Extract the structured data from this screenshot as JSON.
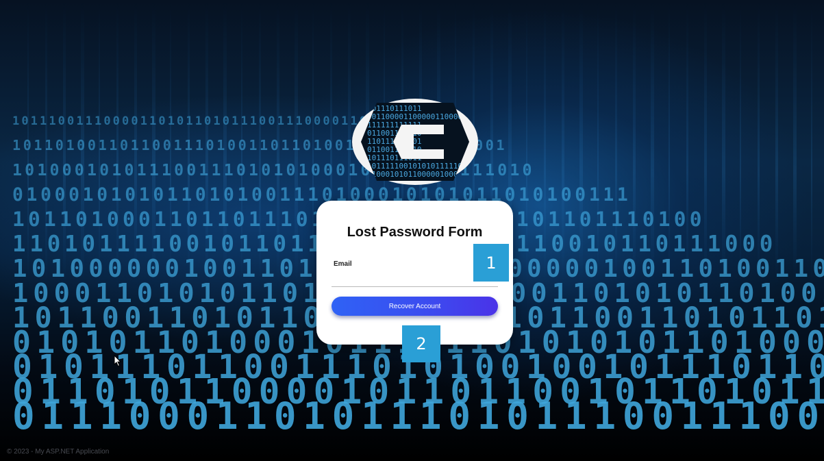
{
  "background": {
    "rows": [
      "1011100111000011010110",
      "10110100110110011101001",
      "101000101011100111010",
      "0100010101011010100111",
      "1011010001101101110100",
      "1101011110010110111000",
      "1010000001001101001101",
      "1000110101011010011101",
      "1011001101011010111010",
      "0101011010001011101101",
      "0101110110011101010010",
      "0110101100001011011001",
      "0111000110101110101110"
    ]
  },
  "footer": {
    "text": "© 2023 - My ASP.NET Application"
  },
  "logo": {
    "binary_rows": [
      "1011",
      "0011000011000",
      "1111",
      "0110",
      "1101",
      "0110",
      "1011",
      "1011111001010",
      "010001010110000"
    ]
  },
  "form": {
    "title": "Lost Password Form",
    "email_label": "Email",
    "email_value": "",
    "button_label": "Recover Account"
  },
  "markers": {
    "m1": "1",
    "m2": "2"
  },
  "colors": {
    "card_bg": "#ffffff",
    "button_start": "#2f62f5",
    "button_end": "#4a33e8",
    "marker": "#2a9fd6",
    "digits": "#3fa6dc"
  }
}
